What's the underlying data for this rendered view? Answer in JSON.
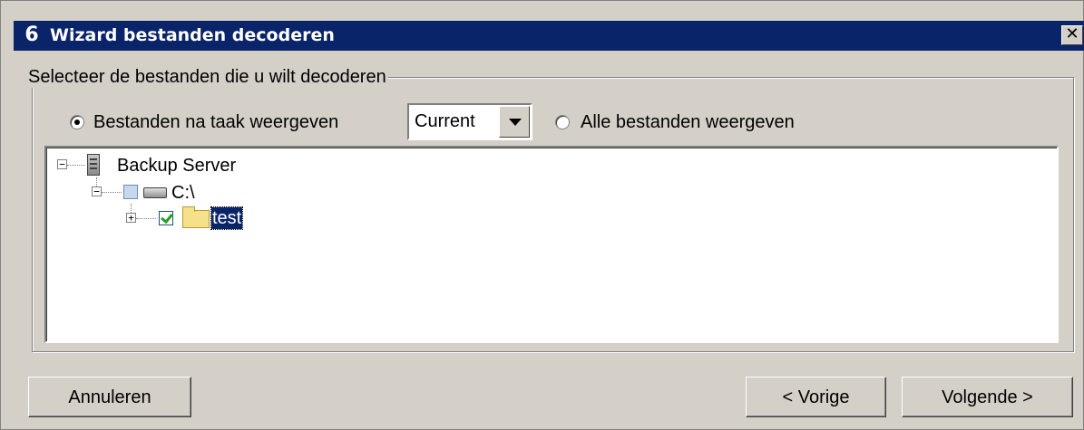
{
  "window": {
    "title": "Wizard bestanden decoderen",
    "app_icon_glyph": "6",
    "close_glyph": "✕"
  },
  "group": {
    "legend": "Selecteer de bestanden die u wilt decoderen"
  },
  "options": {
    "by_job_label": "Bestanden na taak weergeven",
    "by_job_selected": true,
    "job_select_value": "Current",
    "all_files_label": "Alle bestanden weergeven",
    "all_files_selected": false
  },
  "tree": {
    "root_label": "Backup Server",
    "drive_label": "C:\\",
    "folder_label": "test",
    "expanded_glyph": "−",
    "collapsed_glyph": "+"
  },
  "buttons": {
    "cancel": "Annuleren",
    "previous": "< Vorige",
    "next": "Volgende >"
  }
}
